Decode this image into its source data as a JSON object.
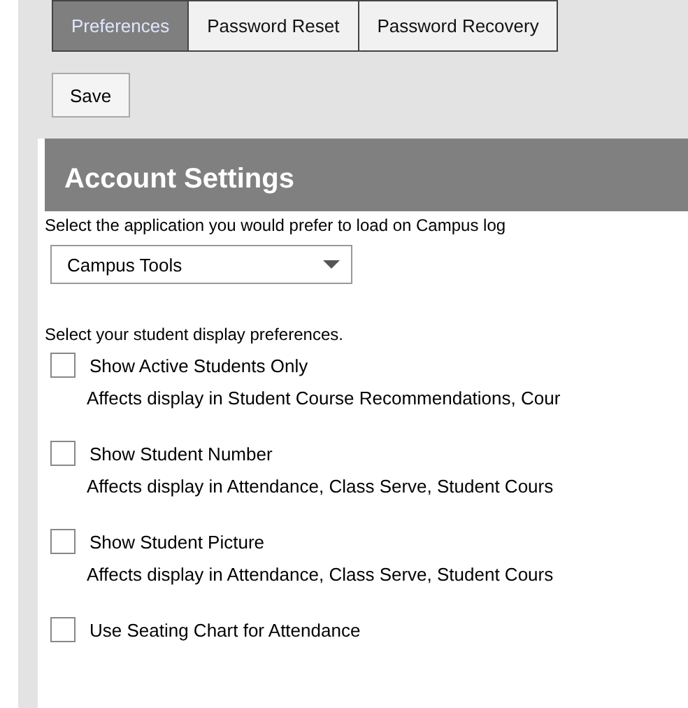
{
  "tabs": [
    {
      "label": "Preferences",
      "selected": true
    },
    {
      "label": "Password Reset",
      "selected": false
    },
    {
      "label": "Password Recovery",
      "selected": false
    }
  ],
  "save_button": "Save",
  "panel": {
    "title": "Account Settings",
    "app_prompt": "Select the application you would prefer to load on Campus log",
    "app_select": {
      "value": "Campus Tools"
    },
    "display_prompt": "Select your student display preferences.",
    "options": [
      {
        "label": "Show Active Students Only",
        "checked": false,
        "note": "Affects display in Student Course Recommendations, Cour"
      },
      {
        "label": "Show Student Number",
        "checked": false,
        "note": "Affects display in Attendance, Class Serve, Student Cours"
      },
      {
        "label": "Show Student Picture",
        "checked": false,
        "note": "Affects display in Attendance, Class Serve, Student Cours"
      },
      {
        "label": "Use Seating Chart for Attendance",
        "checked": false
      }
    ]
  }
}
